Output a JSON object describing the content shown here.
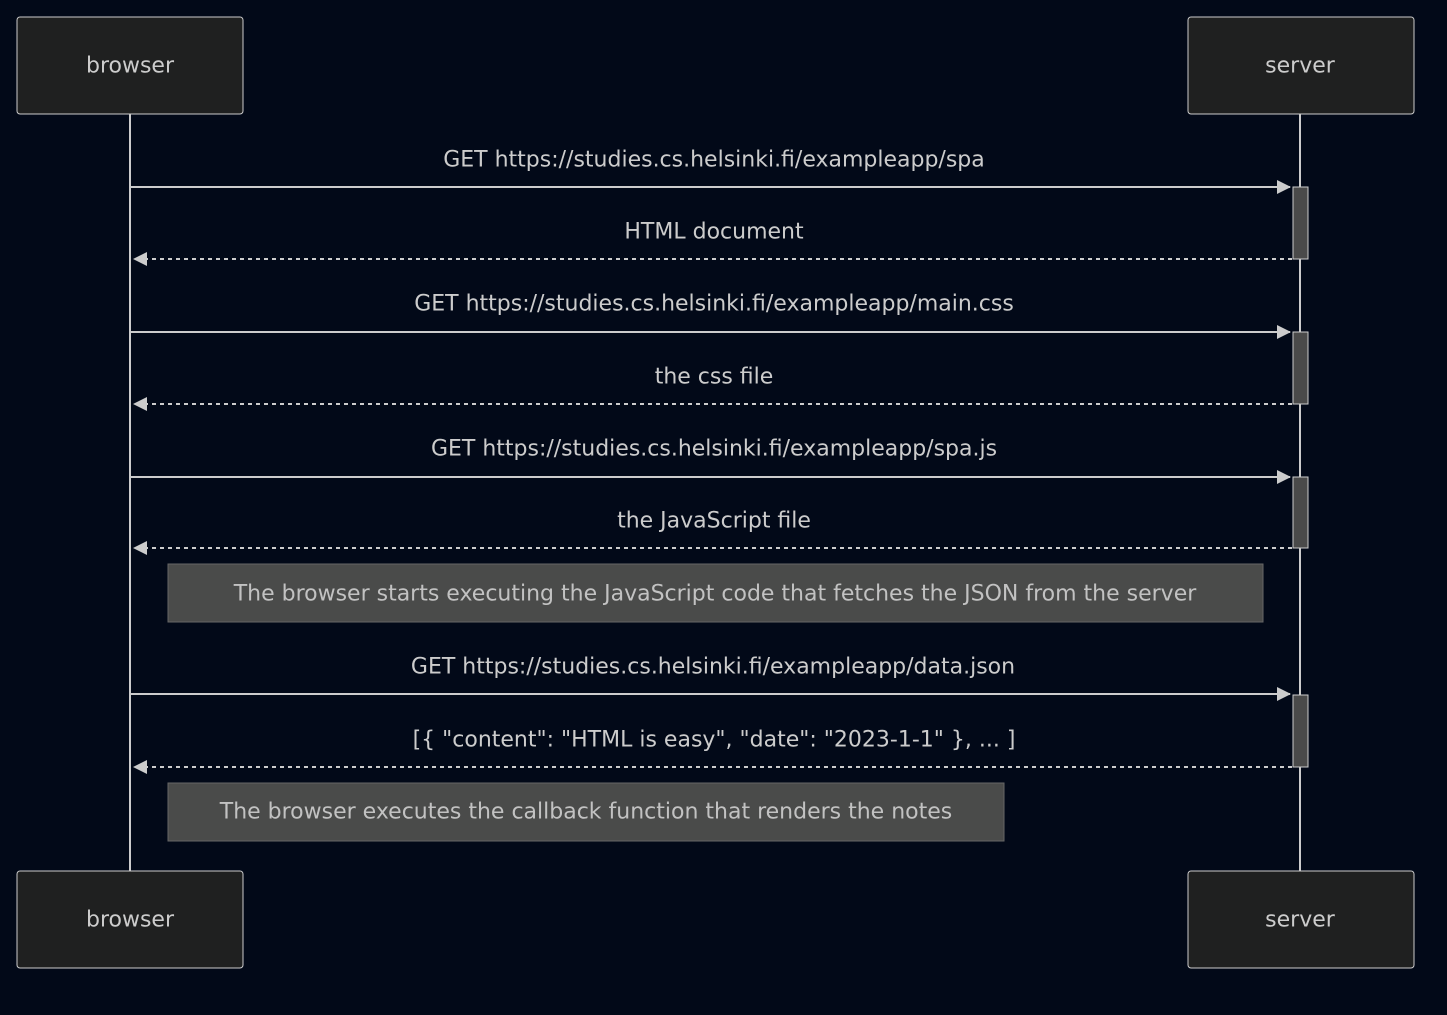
{
  "participants": [
    {
      "id": "browser",
      "label": "browser"
    },
    {
      "id": "server",
      "label": "server"
    }
  ],
  "messages": [
    {
      "from": "browser",
      "to": "server",
      "label": "GET https://studies.cs.helsinki.fi/exampleapp/spa",
      "style": "solid"
    },
    {
      "from": "server",
      "to": "browser",
      "label": "HTML document",
      "style": "dashed"
    },
    {
      "from": "browser",
      "to": "server",
      "label": "GET https://studies.cs.helsinki.fi/exampleapp/main.css",
      "style": "solid"
    },
    {
      "from": "server",
      "to": "browser",
      "label": "the css file",
      "style": "dashed"
    },
    {
      "from": "browser",
      "to": "server",
      "label": "GET https://studies.cs.helsinki.fi/exampleapp/spa.js",
      "style": "solid"
    },
    {
      "from": "server",
      "to": "browser",
      "label": "the JavaScript file",
      "style": "dashed"
    },
    {
      "from": "browser",
      "to": "server",
      "label": "GET https://studies.cs.helsinki.fi/exampleapp/data.json",
      "style": "solid"
    },
    {
      "from": "server",
      "to": "browser",
      "label": "[{ \"content\": \"HTML is easy\", \"date\": \"2023-1-1\" }, ... ]",
      "style": "dashed"
    }
  ],
  "notes": [
    {
      "over": "browser",
      "label": "The browser starts executing the JavaScript code that fetches the JSON from the server"
    },
    {
      "over": "browser",
      "label": "The browser executes the callback function that renders the notes"
    }
  ]
}
